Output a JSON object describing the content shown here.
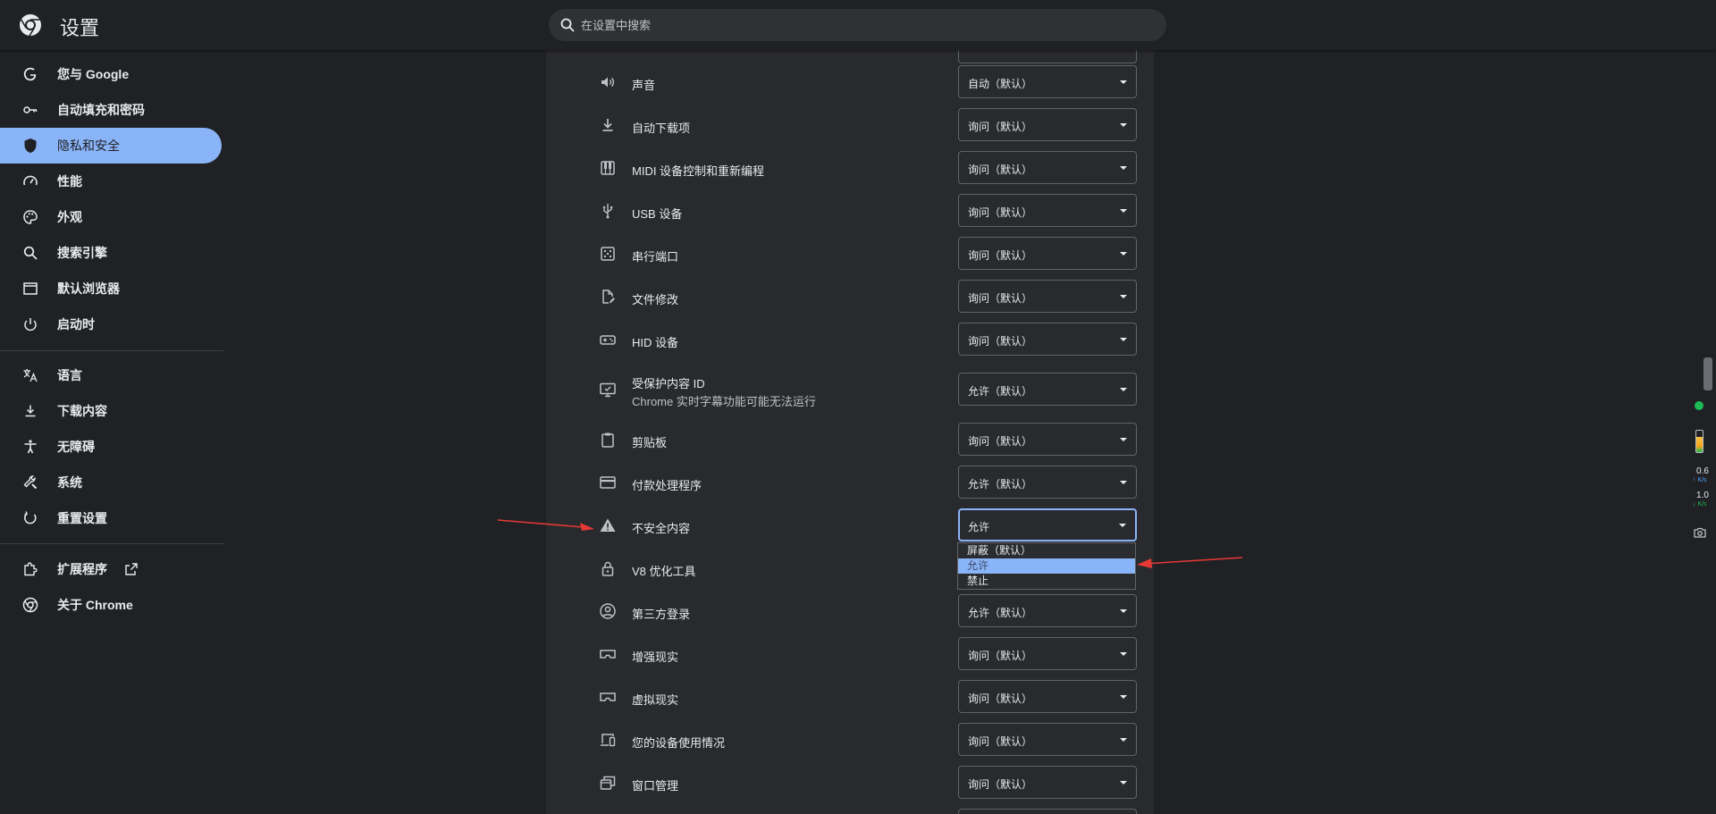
{
  "app": {
    "title": "设置"
  },
  "search": {
    "placeholder": "在设置中搜索"
  },
  "sidebar": {
    "items": [
      {
        "label": "您与 Google",
        "icon": "google-g-icon"
      },
      {
        "label": "自动填充和密码",
        "icon": "key-icon"
      },
      {
        "label": "隐私和安全",
        "icon": "shield-icon",
        "active": true
      },
      {
        "label": "性能",
        "icon": "speedometer-icon"
      },
      {
        "label": "外观",
        "icon": "palette-icon"
      },
      {
        "label": "搜索引擎",
        "icon": "search-icon"
      },
      {
        "label": "默认浏览器",
        "icon": "browser-window-icon"
      },
      {
        "label": "启动时",
        "icon": "power-icon"
      },
      {
        "label": "语言",
        "icon": "translate-icon"
      },
      {
        "label": "下载内容",
        "icon": "download-icon"
      },
      {
        "label": "无障碍",
        "icon": "accessibility-icon"
      },
      {
        "label": "系统",
        "icon": "wrench-icon"
      },
      {
        "label": "重置设置",
        "icon": "reset-icon"
      },
      {
        "label": "扩展程序",
        "icon": "puzzle-icon"
      },
      {
        "label": "关于 Chrome",
        "icon": "chrome-icon"
      }
    ],
    "accent_color": "#8ab4f8"
  },
  "settings": {
    "rows": [
      {
        "label": "声音",
        "value": "自动（默认）",
        "icon": "speaker-icon"
      },
      {
        "label": "自动下载项",
        "value": "询问（默认）",
        "icon": "download-icon"
      },
      {
        "label": "MIDI 设备控制和重新编程",
        "value": "询问（默认）",
        "icon": "piano-icon"
      },
      {
        "label": "USB 设备",
        "value": "询问（默认）",
        "icon": "usb-icon"
      },
      {
        "label": "串行端口",
        "value": "询问（默认）",
        "icon": "serial-port-icon"
      },
      {
        "label": "文件修改",
        "value": "询问（默认）",
        "icon": "file-edit-icon"
      },
      {
        "label": "HID 设备",
        "value": "询问（默认）",
        "icon": "gamepad-icon"
      },
      {
        "label": "受保护内容 ID",
        "sublabel": "Chrome 实时字幕功能可能无法运行",
        "value": "允许（默认）",
        "icon": "protected-content-icon"
      },
      {
        "label": "剪贴板",
        "value": "询问（默认）",
        "icon": "clipboard-icon"
      },
      {
        "label": "付款处理程序",
        "value": "允许（默认）",
        "icon": "credit-card-icon"
      },
      {
        "label": "不安全内容",
        "value": "允许",
        "icon": "warning-icon",
        "focused": true
      },
      {
        "label": "V8 优化工具",
        "value": "",
        "icon": "lock-icon"
      },
      {
        "label": "第三方登录",
        "value": "允许（默认）",
        "icon": "account-circle-icon"
      },
      {
        "label": "增强现实",
        "value": "询问（默认）",
        "icon": "vr-headset-icon"
      },
      {
        "label": "虚拟现实",
        "value": "询问（默认）",
        "icon": "vr-headset-icon"
      },
      {
        "label": "您的设备使用情况",
        "value": "询问（默认）",
        "icon": "devices-icon"
      },
      {
        "label": "窗口管理",
        "value": "询问（默认）",
        "icon": "window-management-icon"
      }
    ],
    "dropdown_options": [
      "屏蔽（默认）",
      "允许",
      "禁止"
    ],
    "dropdown_selected": "允许"
  },
  "side_panel": {
    "upload_value": "0.6",
    "upload_unit": "↑ K/s",
    "download_value": "1.0",
    "download_unit": "↓ K/s",
    "battery_level": 0.7
  }
}
